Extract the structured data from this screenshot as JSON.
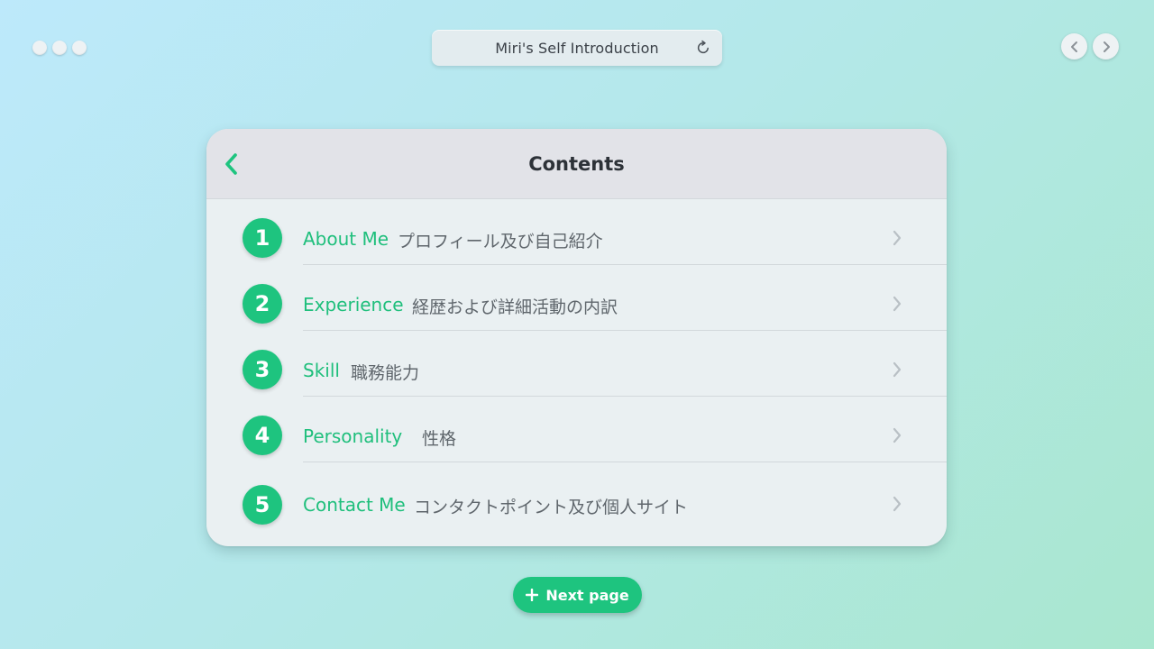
{
  "window": {
    "address_title": "Miri's Self Introduction"
  },
  "card": {
    "title": "Contents",
    "items": [
      {
        "number": "1",
        "label": "About Me",
        "description": "プロフィール及び自己紹介"
      },
      {
        "number": "2",
        "label": "Experience",
        "description": "経歴および詳細活動の内訳"
      },
      {
        "number": "3",
        "label": "Skill",
        "description": "職務能力"
      },
      {
        "number": "4",
        "label": "Personality",
        "description": "性格"
      },
      {
        "number": "5",
        "label": "Contact Me",
        "description": "コンタクトポイント及び個人サイト"
      }
    ]
  },
  "footer": {
    "next_label": "Next page"
  },
  "icons": {
    "window_dots": "dot-icon",
    "refresh": "refresh-icon",
    "nav_back": "chevron-left-icon",
    "nav_forward": "chevron-right-icon",
    "card_back": "chevron-left-icon",
    "row_arrow": "chevron-right-icon",
    "next_page": "plus-icon"
  },
  "colors": {
    "accent": "#1ec47f",
    "title_text": "#2d3238",
    "description_text": "#5f666c",
    "card_background": "#eaf0f2",
    "card_header": "#e2e3e8"
  }
}
